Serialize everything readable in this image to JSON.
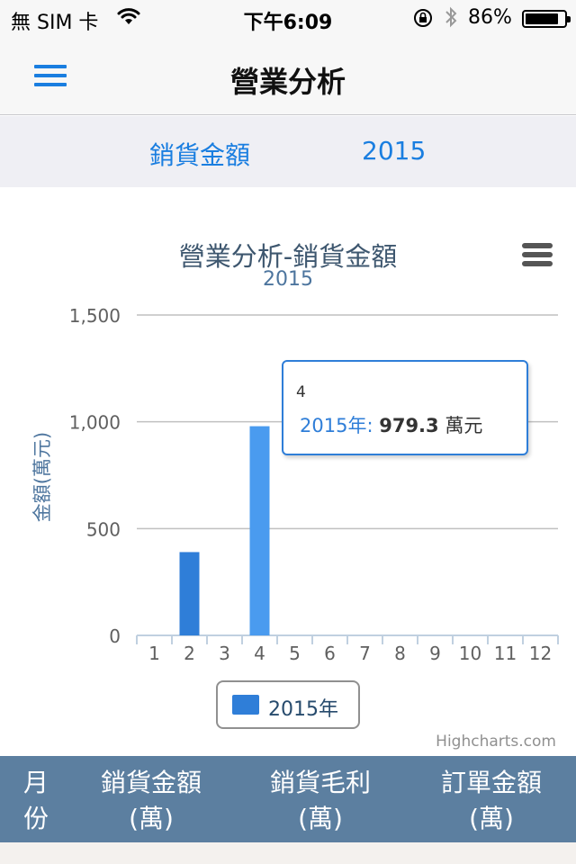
{
  "status_bar": {
    "carrier": "無 SIM 卡",
    "time": "下午6:09",
    "battery": "86%",
    "battery_level": 0.86,
    "icons": [
      "wifi-icon",
      "rotation-lock-icon",
      "bluetooth-icon",
      "battery-icon"
    ]
  },
  "nav": {
    "title": "營業分析",
    "menu_icon": "hamburger-menu-icon"
  },
  "filters": {
    "type": "銷貨金額",
    "year": "2015"
  },
  "colors": {
    "accent": "#1a7ee0",
    "series": "#2f7ed8",
    "highlight": "#4a9bef",
    "header_bg": "#5c7fa0",
    "title": "#3e576f",
    "subtitle": "#4d759e"
  },
  "chart_data": {
    "type": "bar",
    "title": "營業分析-銷貨金額",
    "subtitle": "2015",
    "ylabel": "金額(萬元)",
    "xlabel": "",
    "categories": [
      "1",
      "2",
      "3",
      "4",
      "5",
      "6",
      "7",
      "8",
      "9",
      "10",
      "11",
      "12"
    ],
    "series": [
      {
        "name": "2015年",
        "values": [
          0,
          390,
          0,
          979.3,
          0,
          0,
          0,
          0,
          0,
          0,
          0,
          0
        ]
      }
    ],
    "highlighted_index": 3,
    "ylim": [
      0,
      1500
    ],
    "yticks": [
      0,
      500,
      1000,
      1500
    ],
    "ytick_labels": [
      "0",
      "500",
      "1,000",
      "1,500"
    ],
    "grid": true,
    "legend": "bottom-center",
    "credits": "Highcharts.com",
    "export_icon": "context-menu-icon"
  },
  "tooltip": {
    "header": "4",
    "series_label": "2015年:",
    "value": "979.3",
    "unit": "萬元"
  },
  "table": {
    "headers": [
      {
        "line1": "月",
        "line2": "份"
      },
      {
        "line1": "銷貨金額",
        "line2": "(萬)"
      },
      {
        "line1": "銷貨毛利",
        "line2": "(萬)"
      },
      {
        "line1": "訂單金額",
        "line2": "(萬)"
      }
    ]
  }
}
